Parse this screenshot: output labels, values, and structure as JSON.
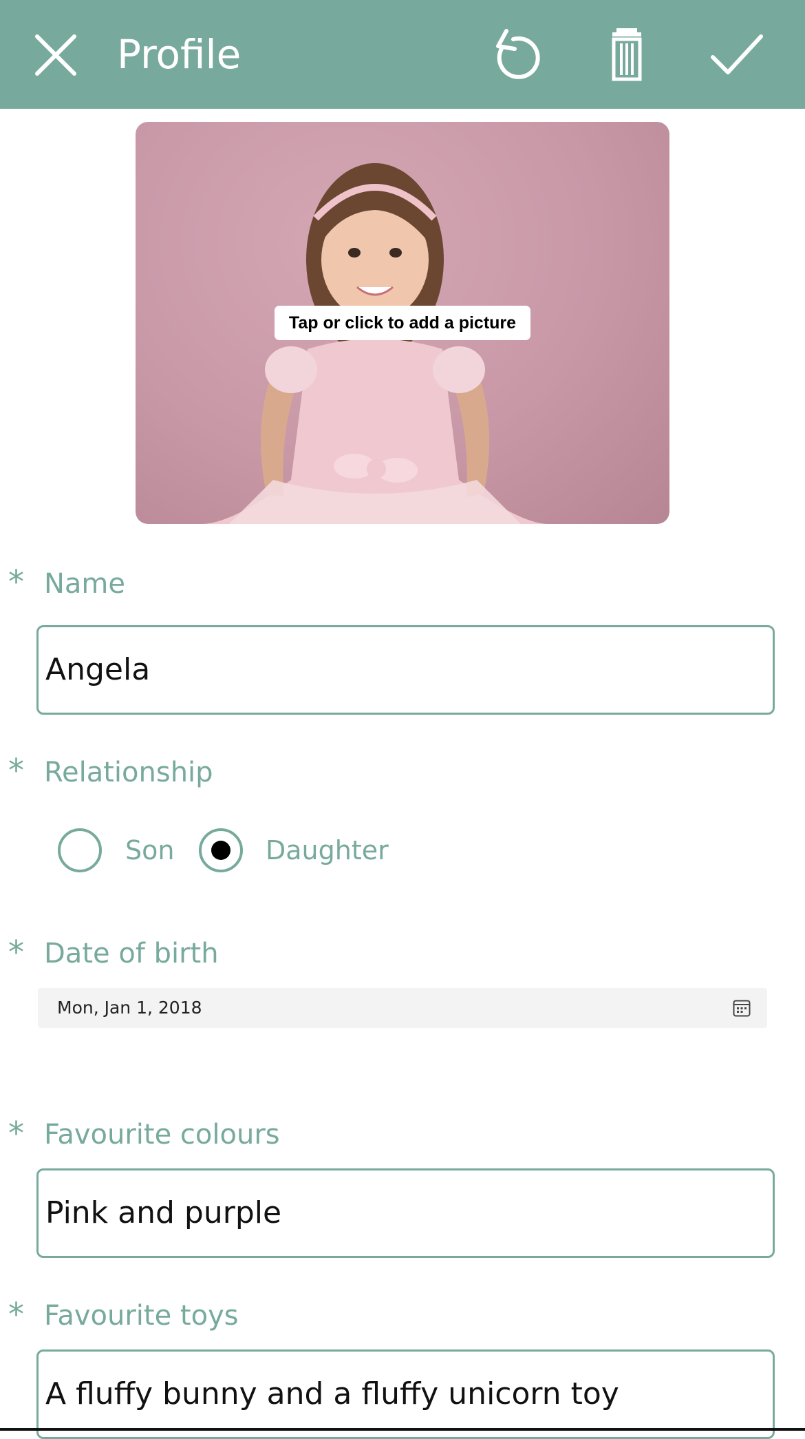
{
  "header": {
    "title": "Profile",
    "close_icon": "close-icon",
    "undo_icon": "undo-icon",
    "delete_icon": "trash-icon",
    "save_icon": "check-icon",
    "background": "#77aa9c"
  },
  "photo": {
    "hint": "Tap or click to add a picture"
  },
  "form": {
    "required_mark": "*",
    "name": {
      "label": "Name",
      "value": "Angela"
    },
    "relationship": {
      "label": "Relationship",
      "options": [
        {
          "label": "Son",
          "selected": false
        },
        {
          "label": "Daughter",
          "selected": true
        }
      ]
    },
    "dob": {
      "label": "Date of birth",
      "value": "Mon, Jan 1, 2018",
      "icon": "calendar-icon"
    },
    "colours": {
      "label": "Favourite colours",
      "value": "Pink and purple"
    },
    "toys": {
      "label": "Favourite toys",
      "value": "A fluffy bunny and a fluffy unicorn toy"
    }
  },
  "accent_color": "#77aa9c"
}
